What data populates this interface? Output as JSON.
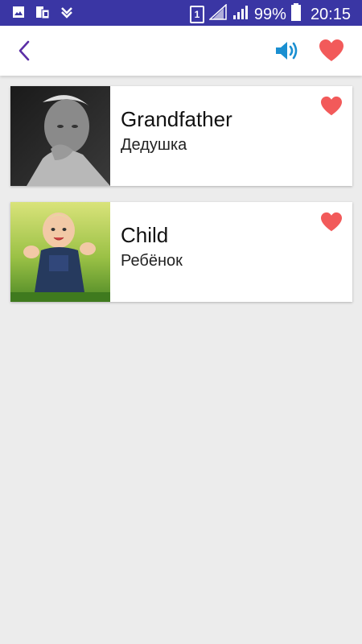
{
  "status_bar": {
    "battery_percent": "99%",
    "time": "20:15",
    "sim_badge": "1",
    "icons": [
      "image-icon",
      "sim-card-icon",
      "check-download-icon",
      "sim-badge-icon",
      "signal-icon",
      "signal-icon",
      "battery-icon"
    ]
  },
  "toolbar": {
    "back_icon": "chevron-left-icon",
    "sound_icon": "speaker-icon",
    "favorite_icon": "heart-icon"
  },
  "colors": {
    "status_bar": "#3a36a4",
    "back": "#5b2ea6",
    "sound": "#1a8fd1",
    "heart": "#f25a5a",
    "background": "#ececec"
  },
  "cards": [
    {
      "title": "Grandfather",
      "subtitle": "Дедушка",
      "image": "elderly-man-photo",
      "favorite": true
    },
    {
      "title": "Child",
      "subtitle": "Ребёнок",
      "image": "baby-on-grass-photo",
      "favorite": true
    }
  ]
}
